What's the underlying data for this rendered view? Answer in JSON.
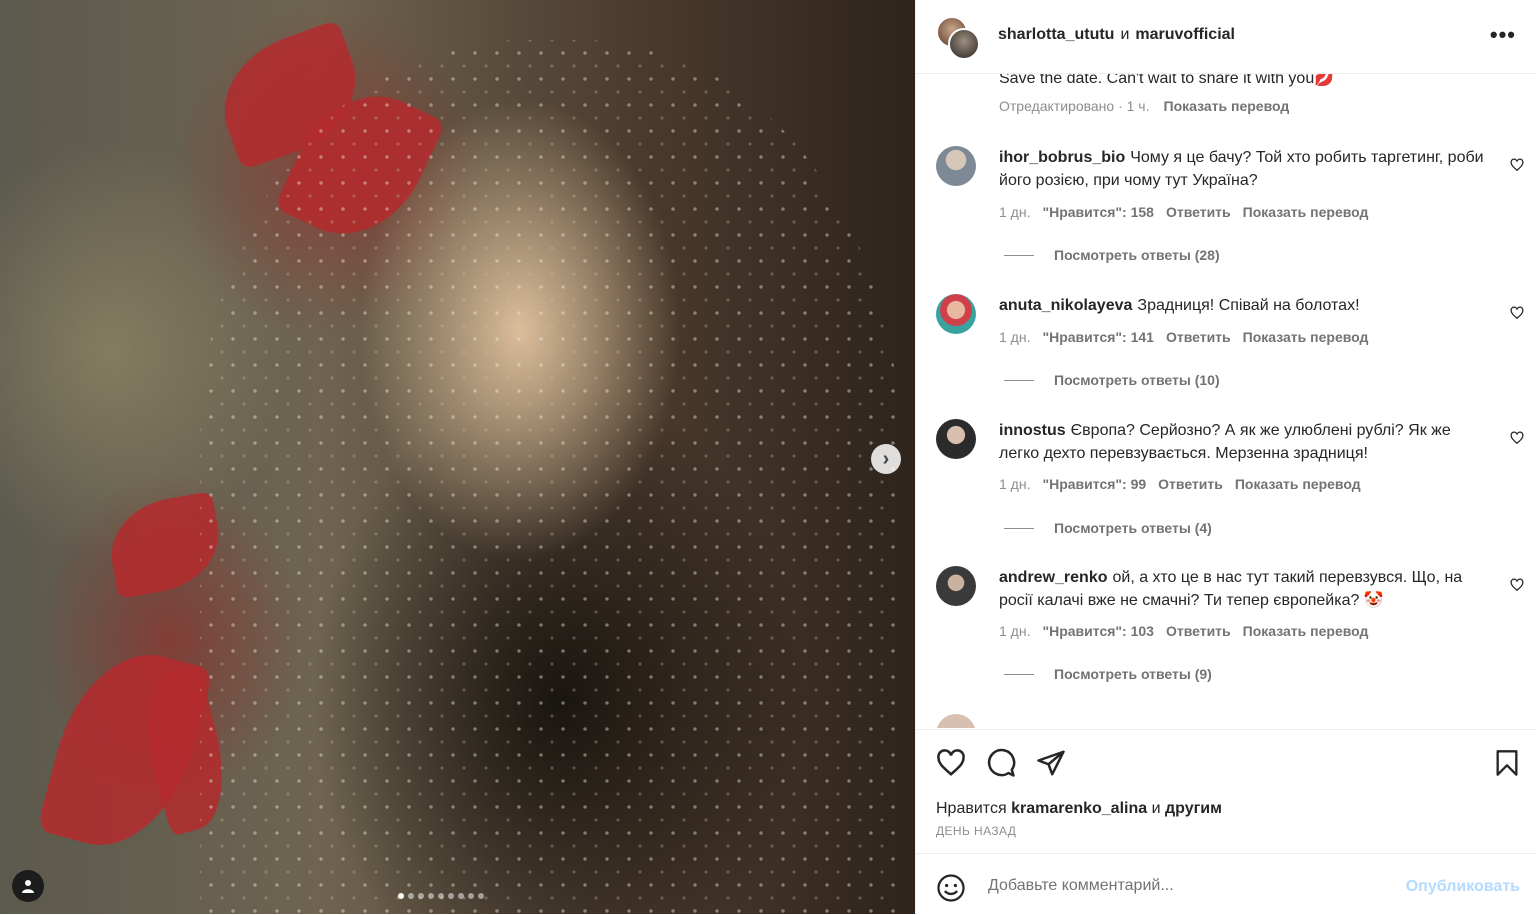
{
  "header": {
    "user1": "sharlotta_ututu",
    "conj": "и",
    "user2": "maruvofficial",
    "more": "•••"
  },
  "caption": {
    "text": "Save the date. Can't wait to share it with you💋",
    "edited": "Отредактировано · 1 ч.",
    "translate": "Показать перевод"
  },
  "comments": [
    {
      "user": "ihor_bobrus_bio",
      "text": "Чому я це бачу? Той хто робить таргетинг, роби його розією, при чому тут Україна?",
      "age": "1 дн.",
      "likes": "\"Нравится\": 158",
      "reply": "Ответить",
      "translate": "Показать перевод",
      "replies": "Посмотреть ответы (28)",
      "avatar_color": "#7d8a96"
    },
    {
      "user": "anuta_nikolayeva",
      "text": "Зрадниця! Співай на болотах!",
      "age": "1 дн.",
      "likes": "\"Нравится\": 141",
      "reply": "Ответить",
      "translate": "Показать перевод",
      "replies": "Посмотреть ответы (10)",
      "avatar_color": "#3aa3a0"
    },
    {
      "user": "innostus",
      "text": "Європа? Серйозно? А як же улюблені рублі? Як же легко дехто перевзувається. Мерзенна зрадниця!",
      "age": "1 дн.",
      "likes": "\"Нравится\": 99",
      "reply": "Ответить",
      "translate": "Показать перевод",
      "replies": "Посмотреть ответы (4)",
      "avatar_color": "#2b2b2b"
    },
    {
      "user": "andrew_renko",
      "text": "ой, а хто це в нас тут такий перевзувся. Що, на росії калачі вже не смачні? Ти тепер європейка? 🤡",
      "age": "1 дн.",
      "likes": "\"Нравится\": 103",
      "reply": "Ответить",
      "translate": "Показать перевод",
      "replies": "Посмотреть ответы (9)",
      "avatar_color": "#3a3a3a"
    }
  ],
  "likes": {
    "prefix": "Нравится",
    "user": "kramarenko_alina",
    "and": "и",
    "others": "другим"
  },
  "time": "ДЕНЬ НАЗАД",
  "add_comment": {
    "placeholder": "Добавьте комментарий...",
    "publish": "Опубликовать"
  }
}
